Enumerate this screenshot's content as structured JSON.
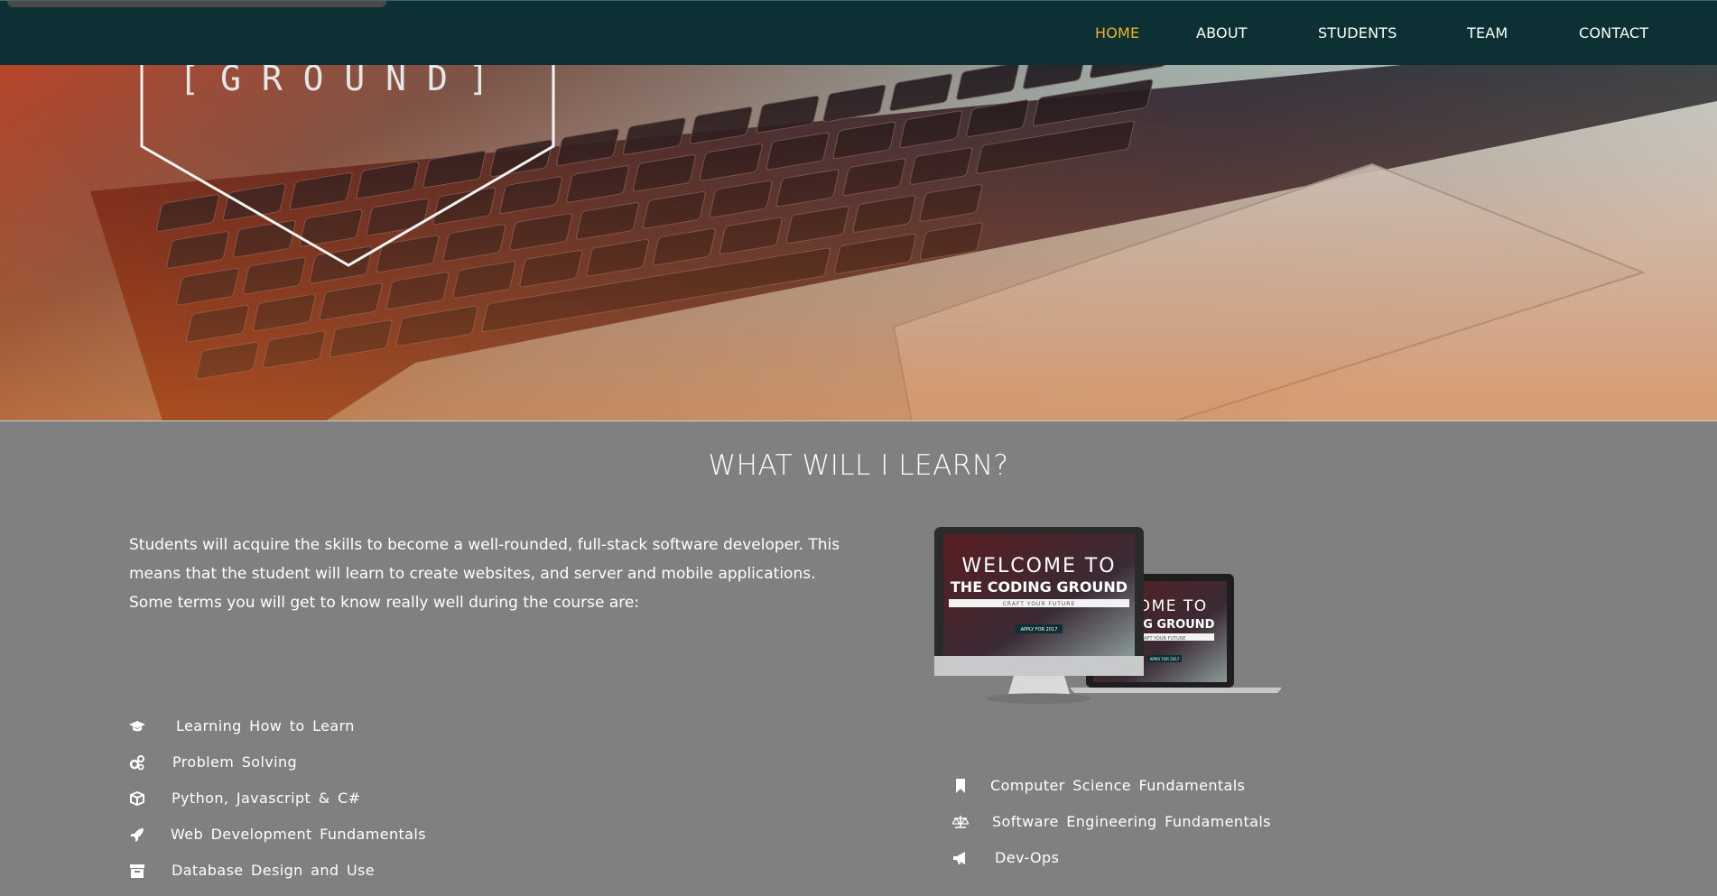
{
  "nav": {
    "links": [
      {
        "label": "HOME",
        "active": true
      },
      {
        "label": "ABOUT",
        "active": false
      },
      {
        "label": "STUDENTS",
        "active": false
      },
      {
        "label": "TEAM",
        "active": false
      },
      {
        "label": "CONTACT",
        "active": false
      }
    ],
    "active_color": "#f0b429",
    "background": "#0c3033"
  },
  "hero": {
    "logo_text": "[ G R O U N D ]"
  },
  "learn": {
    "title": "WHAT WILL I LEARN?",
    "intro": "Students will acquire the skills to become a well-rounded, full-stack software developer. This means that the student will learn to create websites, and server and mobile applications. Some terms you will get to know really well during the course are:",
    "left_items": [
      {
        "icon": "graduation-cap-icon",
        "label": "Learning How to Learn"
      },
      {
        "icon": "cogs-icon",
        "label": "Problem Solving"
      },
      {
        "icon": "cube-icon",
        "label": "Python, Javascript & C#"
      },
      {
        "icon": "rocket-icon",
        "label": "Web Development Fundamentals"
      },
      {
        "icon": "archive-icon",
        "label": "Database Design and Use"
      }
    ],
    "right_items": [
      {
        "icon": "bookmark-icon",
        "label": "Computer Science Fundamentals"
      },
      {
        "icon": "balance-scale-icon",
        "label": "Software Engineering Fundamentals"
      },
      {
        "icon": "bullhorn-icon",
        "label": "Dev-Ops"
      }
    ]
  },
  "devices_image": {
    "desktop_line1": "WELCOME TO",
    "desktop_line2": "THE CODING GROUND",
    "desktop_line3": "CRAFT YOUR FUTURE",
    "desktop_button": "APPLY FOR 2017",
    "laptop_line1": "LCOME TO",
    "laptop_line2": "ODING GROUND",
    "laptop_line3": "CRAFT YOUR FUTURE",
    "laptop_button": "APPLY FOR 2017"
  }
}
